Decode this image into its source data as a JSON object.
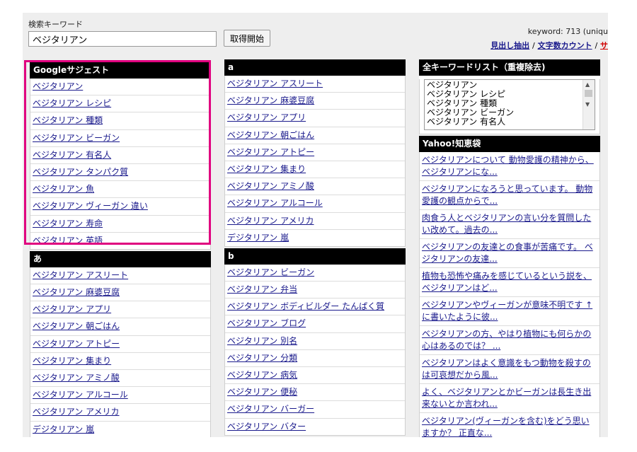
{
  "search": {
    "label": "検索キーワード",
    "value": "ベジタリアン",
    "button": "取得開始"
  },
  "stats": {
    "keyword_count": "keyword: 713 (uniqu"
  },
  "tools": {
    "link1": "見出し抽出",
    "sep1": "/",
    "link2": "文字数カウント",
    "sep2": "/",
    "link3": "サ"
  },
  "google": {
    "title": "Googleサジェスト",
    "items": [
      "ベジタリアン",
      "ベジタリアン レシピ",
      "ベジタリアン 種類",
      "ベジタリアン ビーガン",
      "ベジタリアン 有名人",
      "ベジタリアン タンパク質",
      "ベジタリアン 魚",
      "ベジタリアン ヴィーガン 違い",
      "ベジタリアン 寿命",
      "ベジタリアン 英語"
    ]
  },
  "kana_a": {
    "title": "あ",
    "items": [
      "ベジタリアン アスリート",
      "ベジタリアン 麻婆豆腐",
      "ベジタリアン アプリ",
      "ベジタリアン 朝ごはん",
      "ベジタリアン アトピー",
      "ベジタリアン 集まり",
      "ベジタリアン アミノ酸",
      "ベジタリアン アルコール",
      "ベジタリアン アメリカ",
      "デジタリアン 嵐"
    ]
  },
  "alpha_a": {
    "title": "a",
    "items": [
      "ベジタリアン アスリート",
      "ベジタリアン 麻婆豆腐",
      "ベジタリアン アプリ",
      "ベジタリアン 朝ごはん",
      "ベジタリアン アトピー",
      "ベジタリアン 集まり",
      "ベジタリアン アミノ酸",
      "ベジタリアン アルコール",
      "ベジタリアン アメリカ",
      "デジタリアン 嵐"
    ]
  },
  "alpha_b": {
    "title": "b",
    "items": [
      "ベジタリアン ビーガン",
      "ベジタリアン 弁当",
      "ベジタリアン ボディビルダー たんぱく質",
      "ベジタリアン ブログ",
      "ベジタリアン 別名",
      "ベジタリアン 分類",
      "ベジタリアン 病気",
      "ベジタリアン 便秘",
      "ベジタリアン バーガー",
      "ベジタリアン バター"
    ]
  },
  "all_keywords": {
    "title": "全キーワードリスト（重複除去)",
    "lines": [
      "ベジタリアン",
      "ベジタリアン レシピ",
      "ベジタリアン 種類",
      "ベジタリアン ビーガン",
      "ベジタリアン 有名人"
    ]
  },
  "yahoo": {
    "title": "Yahoo!知恵袋",
    "items": [
      "ベジタリアンについて 動物愛護の精神から、ベジタリアンにな...",
      "ベジタリアンになろうと思っています。 動物愛護の観点からで...",
      "肉食う人とベジタリアンの言い分を質問したい改めて。過去の...",
      "ベジタリアンの友達との食事が苦痛です。 ベジタリアンの友達...",
      "植物も恐怖や痛みを感じているという説を、ベジタリアンはど...",
      "ベジタリアンやヴィーガンが意味不明です ↑に書いたように彼...",
      "ベジタリアンの方、やはり植物にも何らかの心はあるのでは？ ...",
      "ベジタリアンはよく意識をもつ動物を殺すのは可哀想だから風...",
      "よく、ベジタリアンとかビーガンは長生き出来ないとか言われ...",
      "ベジタリアン(ヴィーガンを含む)をどう思いますか？ 正直な..."
    ]
  },
  "colors": {
    "highlight": "#e0007f",
    "link": "#1a1a8c",
    "header": "#000000"
  }
}
